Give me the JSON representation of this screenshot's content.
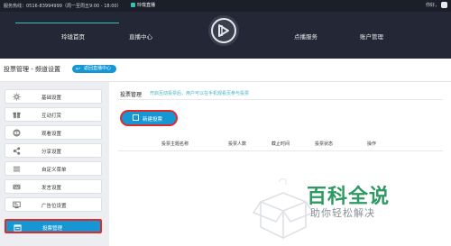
{
  "topbar": {
    "hotline": "服务热线：0516-83994999（周一至周五9:00 - 18:00）",
    "brand": "玲珑直播",
    "user": "你好，"
  },
  "nav": {
    "items": [
      "玲珑首页",
      "直播中心",
      "点播服务",
      "账户管理"
    ]
  },
  "page": {
    "title": "投票管理 - 频道设置",
    "back_button": "返回直播中心"
  },
  "sidebar": {
    "items": [
      {
        "label": "基础设置",
        "icon": "gear-icon"
      },
      {
        "label": "互动打赏",
        "icon": "gift-icon"
      },
      {
        "label": "观看设置",
        "icon": "eye-icon"
      },
      {
        "label": "分享设置",
        "icon": "share-icon"
      },
      {
        "label": "自定义菜单",
        "icon": "menu-icon"
      },
      {
        "label": "发言设置",
        "icon": "keyboard-icon"
      },
      {
        "label": "广告位设置",
        "icon": "ad-icon"
      },
      {
        "label": "投票管理",
        "icon": "vote-icon",
        "active": true
      }
    ]
  },
  "content": {
    "title": "投票管理",
    "description": "开启互动投票后，用户可以在手机观看页参与投票",
    "new_button": "新建投票",
    "table_headers": [
      "投票主题名称",
      "投票人数",
      "截止时间",
      "投票状态",
      "操作"
    ]
  },
  "watermark": {
    "title": "百科全说",
    "subtitle": "助你轻松解决"
  },
  "colors": {
    "accent": "#1597d4",
    "highlight": "#e02a2a",
    "nav_bg": "#242735",
    "watermark_green": "#2d9a62"
  }
}
